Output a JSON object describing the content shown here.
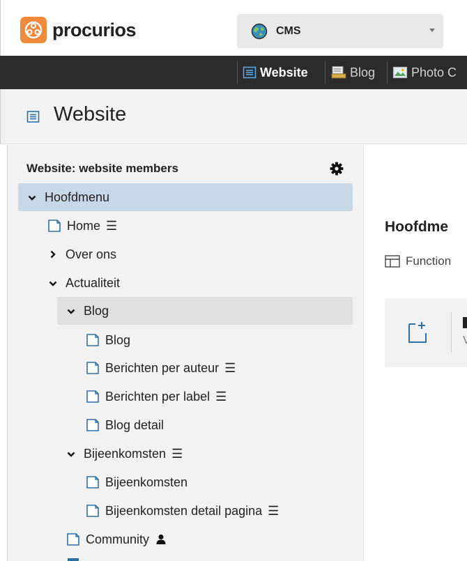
{
  "brand": {
    "name": "procurios",
    "accent": "#f08a3c"
  },
  "site_selector": {
    "value": "CMS",
    "icon": "globe-icon"
  },
  "nav": {
    "items": [
      {
        "label": "Website",
        "icon": "list-icon",
        "active": true
      },
      {
        "label": "Blog",
        "icon": "blog-icon",
        "active": false
      },
      {
        "label": "Photo C",
        "icon": "photo-icon",
        "active": false
      }
    ]
  },
  "page": {
    "title": "Website",
    "icon": "list-icon"
  },
  "tree": {
    "heading": "Website: website members",
    "items": [
      {
        "label": "Hoofdmenu",
        "level": 0,
        "chevron": "down",
        "selected": true
      },
      {
        "label": "Home",
        "level": 1,
        "icon": "page-icon",
        "menu": true
      },
      {
        "label": "Over ons",
        "level": 1,
        "chevron": "right"
      },
      {
        "label": "Actualiteit",
        "level": 1,
        "chevron": "down"
      },
      {
        "label": "Blog",
        "level": 2,
        "chevron": "down",
        "highlighted": true
      },
      {
        "label": "Blog",
        "level": 3,
        "icon": "page-icon"
      },
      {
        "label": "Berichten per auteur",
        "level": 3,
        "icon": "page-icon",
        "menu": true
      },
      {
        "label": "Berichten per label",
        "level": 3,
        "icon": "page-icon",
        "menu": true
      },
      {
        "label": "Blog detail",
        "level": 3,
        "icon": "page-icon"
      },
      {
        "label": "Bijeenkomsten",
        "level": 2,
        "chevron": "down",
        "menu": true
      },
      {
        "label": "Bijeenkomsten",
        "level": 3,
        "icon": "page-icon"
      },
      {
        "label": "Bijeenkomsten detail pagina",
        "level": 3,
        "icon": "page-icon",
        "menu": true
      },
      {
        "label": "Community",
        "level": 2,
        "icon": "page-icon",
        "person": true
      }
    ]
  },
  "content": {
    "title": "Hoofdme",
    "function_label": "Function",
    "card_stub": "V"
  }
}
